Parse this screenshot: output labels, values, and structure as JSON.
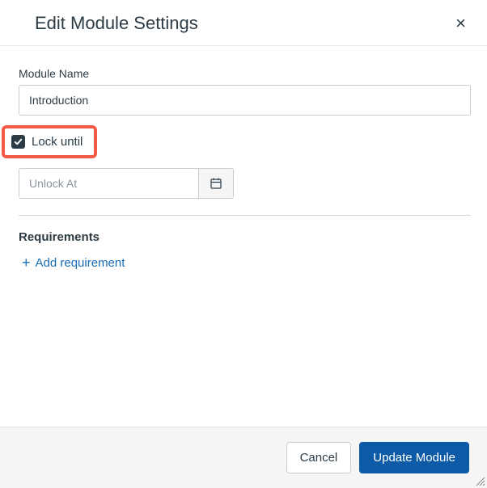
{
  "header": {
    "title": "Edit Module Settings"
  },
  "form": {
    "moduleNameLabel": "Module Name",
    "moduleNameValue": "Introduction",
    "lockUntil": {
      "checked": true,
      "label": "Lock until"
    },
    "unlockAt": {
      "placeholder": "Unlock At",
      "value": ""
    }
  },
  "requirements": {
    "title": "Requirements",
    "addLabel": "Add requirement"
  },
  "footer": {
    "cancel": "Cancel",
    "update": "Update Module"
  }
}
